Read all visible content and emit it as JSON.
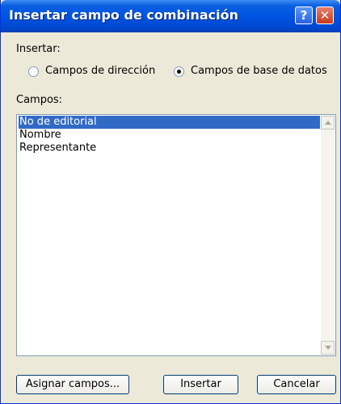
{
  "window": {
    "title": "Insertar campo de combinación",
    "help_glyph": "?",
    "close_glyph": "✕"
  },
  "insert_section": {
    "label": "Insertar:",
    "radio_address": {
      "label": "Campos de dirección",
      "selected": false
    },
    "radio_database": {
      "label": "Campos de base de datos",
      "selected": true
    }
  },
  "fields_section": {
    "label": "Campos:",
    "items": [
      "No de editorial",
      "Nombre",
      "Representante"
    ],
    "selected_index": 0
  },
  "buttons": {
    "assign": "Asignar campos...",
    "insert": "Insertar",
    "cancel": "Cancelar"
  },
  "colors": {
    "titlebar": "#0054e3",
    "selection": "#316ac5",
    "dialog_bg": "#ece9d8"
  }
}
